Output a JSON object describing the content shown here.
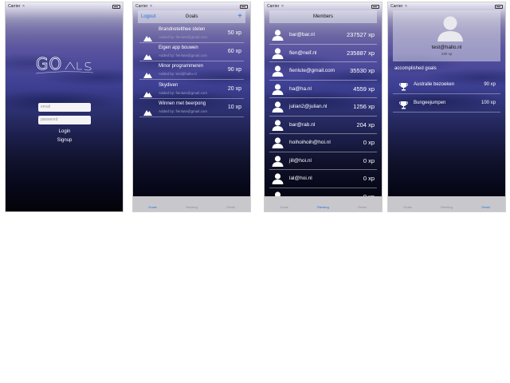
{
  "status": {
    "carrier": "Carrier"
  },
  "login": {
    "logo": "GOALS",
    "email_placeholder": "email",
    "password_placeholder": "password",
    "login_label": "Login",
    "signup_label": "Signup"
  },
  "goals_screen": {
    "logout": "Logout",
    "title": "Goals",
    "add": "+",
    "items": [
      {
        "title": "Brandnetelthee stelen",
        "added_by": "Added by: fienlute@gmail.com",
        "xp": "50 xp"
      },
      {
        "title": "Eigen app bouwen",
        "added_by": "Added by: fienlute@gmail.com",
        "xp": "60 xp"
      },
      {
        "title": "Minor programmeren",
        "added_by": "Added by: test@hallo.nl",
        "xp": "90 xp"
      },
      {
        "title": "Skydiven",
        "added_by": "Added by: fienlute@gmail.com",
        "xp": "20 xp"
      },
      {
        "title": "Winnen met beerpong",
        "added_by": "Added by: fienlute@gmail.com",
        "xp": "10 xp"
      }
    ]
  },
  "members_screen": {
    "title": "Members",
    "items": [
      {
        "name": "bar@bar.nl",
        "xp": "237527 xp"
      },
      {
        "name": "fien@neif.nl",
        "xp": "235887 xp"
      },
      {
        "name": "fienlute@gmail.com",
        "xp": "35530 xp"
      },
      {
        "name": "ha@ha.nl",
        "xp": "4559 xp"
      },
      {
        "name": "julian2@julian.nl",
        "xp": "1256 xp"
      },
      {
        "name": "bar@rab.nl",
        "xp": "204 xp"
      },
      {
        "name": "hoihoihoih@hoi.nl",
        "xp": "0 xp"
      },
      {
        "name": "jill@hoi.nl",
        "xp": "0 xp"
      },
      {
        "name": "lal@hoi.nl",
        "xp": "0 xp"
      },
      {
        "name": "",
        "xp": "0 xp"
      }
    ]
  },
  "profile_screen": {
    "email": "test@hallo.nl",
    "xp": "190 xp",
    "section_label": "accomplished goals",
    "items": [
      {
        "name": "Australie bezoeken",
        "xp": "90 xp"
      },
      {
        "name": "Bungeejumpen",
        "xp": "100 xp"
      }
    ]
  },
  "tabs": [
    "Goals",
    "Ranking",
    "Detail"
  ],
  "colors": {
    "accent": "#2a6fdb",
    "tabbar": "#c8c8cc"
  },
  "icons": [
    "mountain-icon",
    "person-icon",
    "trophy-icon",
    "wifi-icon",
    "battery-icon",
    "plus-icon"
  ]
}
